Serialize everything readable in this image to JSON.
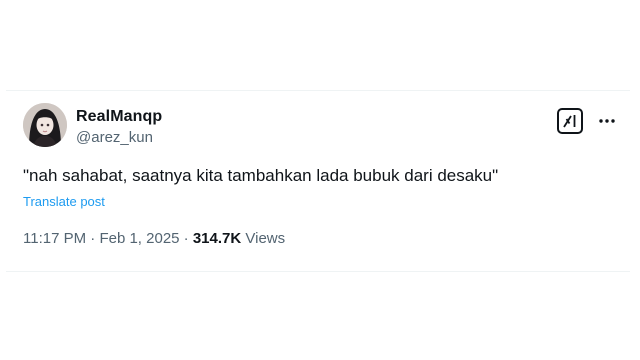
{
  "post": {
    "display_name": "RealManqp",
    "handle": "@arez_kun",
    "text": "\"nah sahabat, saatnya kita tambahkan lada bubuk dari desaku\"",
    "translate_label": "Translate post",
    "time": "11:17 PM",
    "separator": " · ",
    "date": "Feb 1, 2025",
    "views_count": "314.7K",
    "views_label": "Views"
  },
  "icons": {
    "grok": "grok-icon",
    "more": "more-icon",
    "avatar": "avatar"
  },
  "colors": {
    "text": "#0f1419",
    "secondary": "#536471",
    "link": "#1d9bf0",
    "border": "#eff3f4"
  }
}
